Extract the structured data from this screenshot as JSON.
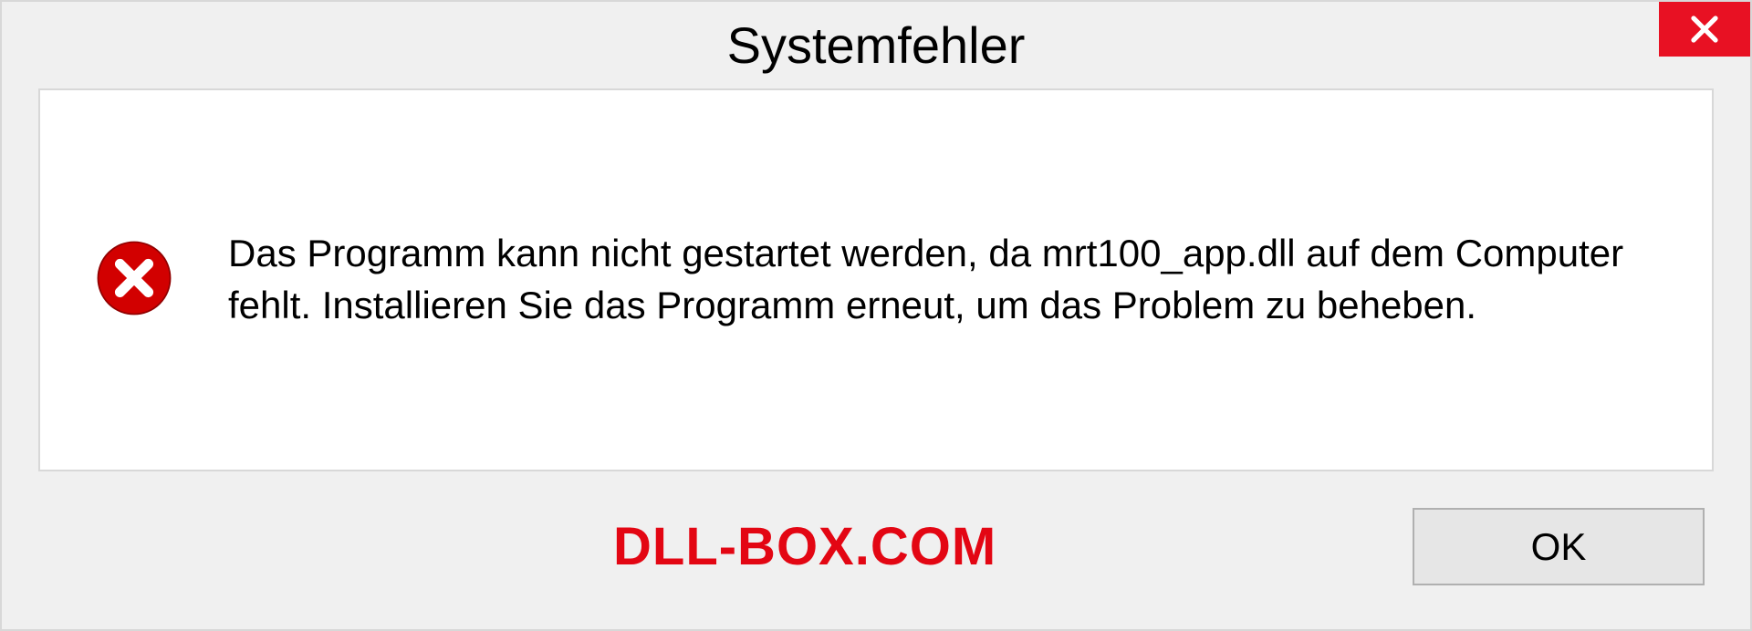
{
  "dialog": {
    "title": "Systemfehler",
    "message": "Das Programm kann nicht gestartet werden, da mrt100_app.dll auf dem Computer fehlt. Installieren Sie das Programm erneut, um das Problem zu beheben.",
    "ok_label": "OK"
  },
  "watermark": "DLL-BOX.COM",
  "colors": {
    "close_bg": "#e81123",
    "error_icon": "#d20000",
    "watermark": "#e30613"
  }
}
